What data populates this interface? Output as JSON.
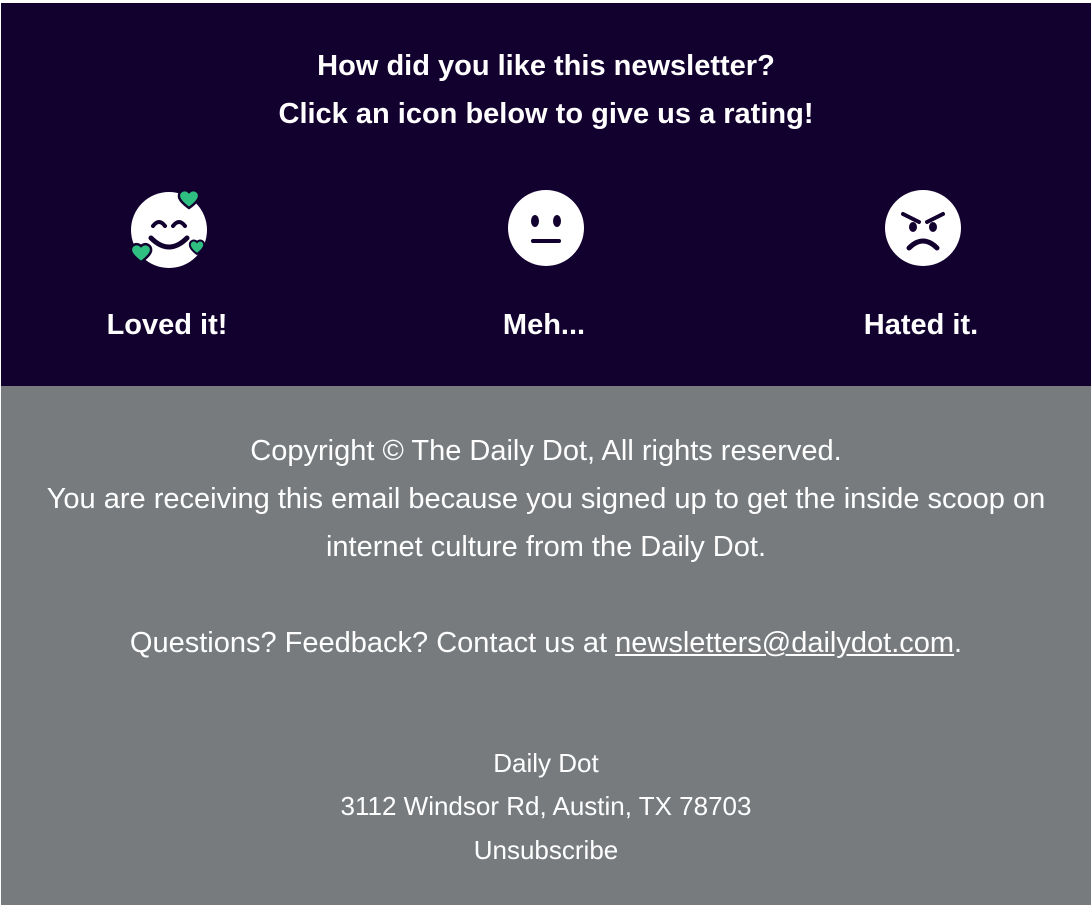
{
  "rating": {
    "heading_line1": "How did you like this newsletter?",
    "heading_line2": "Click an icon below to give us a rating!",
    "background_color": "#12002f",
    "options": [
      {
        "label": "Loved it!",
        "icon": "smiling-face-with-hearts-icon"
      },
      {
        "label": "Meh...",
        "icon": "neutral-face-icon"
      },
      {
        "label": "Hated it.",
        "icon": "angry-face-icon"
      }
    ],
    "heart_color": "#2fbf80"
  },
  "footer": {
    "background_color": "#777b7e",
    "copyright": "Copyright © The Daily Dot, All rights reserved.",
    "notice_line1": "You are receiving this email because you signed up to get the inside scoop on",
    "notice_line2": "internet culture from the Daily Dot.",
    "contact_prefix": "Questions? Feedback? Contact us at ",
    "contact_email": "newsletters@dailydot.com",
    "contact_suffix": ".",
    "company_name": "Daily Dot",
    "address": "3112 Windsor Rd, Austin, TX 78703",
    "unsubscribe_label": "Unsubscribe"
  }
}
